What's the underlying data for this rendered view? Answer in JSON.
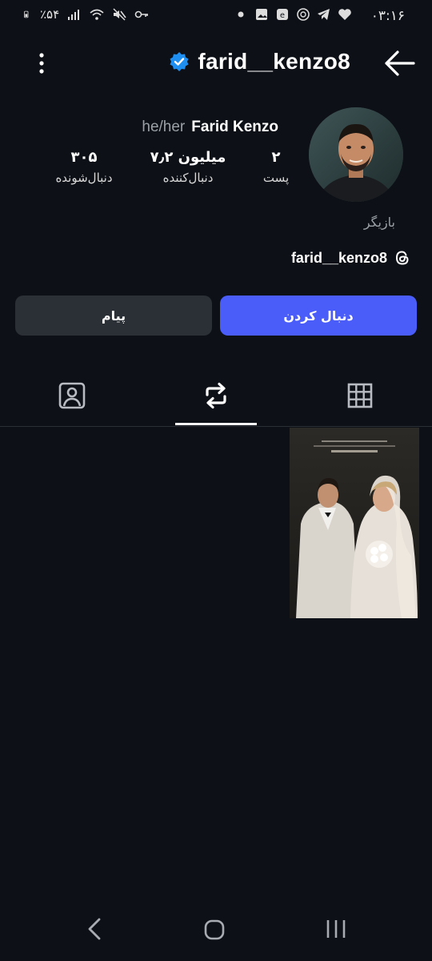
{
  "status_bar": {
    "time": "۰۳:۱۶",
    "battery_percent": "٪۵۴",
    "notification_icons": [
      "heart-icon",
      "telegram-icon",
      "chatgpt-icon",
      "edge-icon",
      "gallery-icon",
      "dot-icon"
    ],
    "system_icons": [
      "battery-icon",
      "signal-icon",
      "wifi-icon",
      "mute-icon",
      "key-icon"
    ]
  },
  "header": {
    "username": "farid__kenzo8",
    "verified": true
  },
  "profile": {
    "display_name": "Farid Kenzo",
    "pronouns": "he/her",
    "stats": {
      "posts_value": "۲",
      "posts_label": "پست",
      "followers_value": "۷٫۲ میلیون",
      "followers_label": "دنبال‌کننده",
      "following_value": "۳۰۵",
      "following_label": "دنبال‌شونده"
    },
    "category": "بازیگر",
    "threads_handle": "farid__kenzo8"
  },
  "actions": {
    "follow_label": "دنبال کردن",
    "message_label": "پیام"
  },
  "tabs": [
    {
      "name": "grid",
      "icon": "grid-icon",
      "active": false
    },
    {
      "name": "reposts",
      "icon": "repost-icon",
      "active": true
    },
    {
      "name": "tagged",
      "icon": "tagged-person-icon",
      "active": false
    }
  ],
  "colors": {
    "background": "#0d1117",
    "accent": "#4a5df9",
    "secondary_button": "#2b2f36",
    "verified_blue": "#1f8ef1"
  }
}
